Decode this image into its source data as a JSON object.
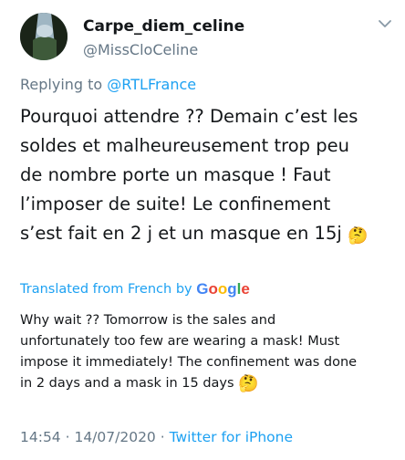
{
  "user": {
    "display_name": "Carpe_diem_celine",
    "handle": "@MissCloCeline"
  },
  "reply": {
    "prefix": "Replying to ",
    "mention": "@RTLFrance"
  },
  "tweet": {
    "lines": [
      "Pourquoi attendre ?? Demain c’est les",
      "soldes et malheureusement trop peu",
      "de nombre porte un masque ! Faut",
      "l’imposer de suite! Le confinement",
      "s’est fait en 2 j et un masque en 15j"
    ],
    "emoji": "🤔"
  },
  "translation": {
    "label": "Translated from French by",
    "provider_letters": [
      "G",
      "o",
      "o",
      "g",
      "l",
      "e"
    ],
    "lines": [
      "Why wait ?? Tomorrow is the sales and",
      "unfortunately too few are wearing a mask! Must",
      "impose it immediately! The confinement was done",
      "in 2 days and a mask in 15 days"
    ],
    "emoji": "🤔"
  },
  "meta": {
    "time": "14:54",
    "sep1": " · ",
    "date": "14/07/2020",
    "sep2": " · ",
    "source": "Twitter for iPhone"
  },
  "colors": {
    "link": "#1da1f2",
    "secondary": "#657786",
    "text": "#14171a"
  },
  "icons": {
    "menu": "chevron-down-icon",
    "emoji": "thinking-face-icon"
  }
}
